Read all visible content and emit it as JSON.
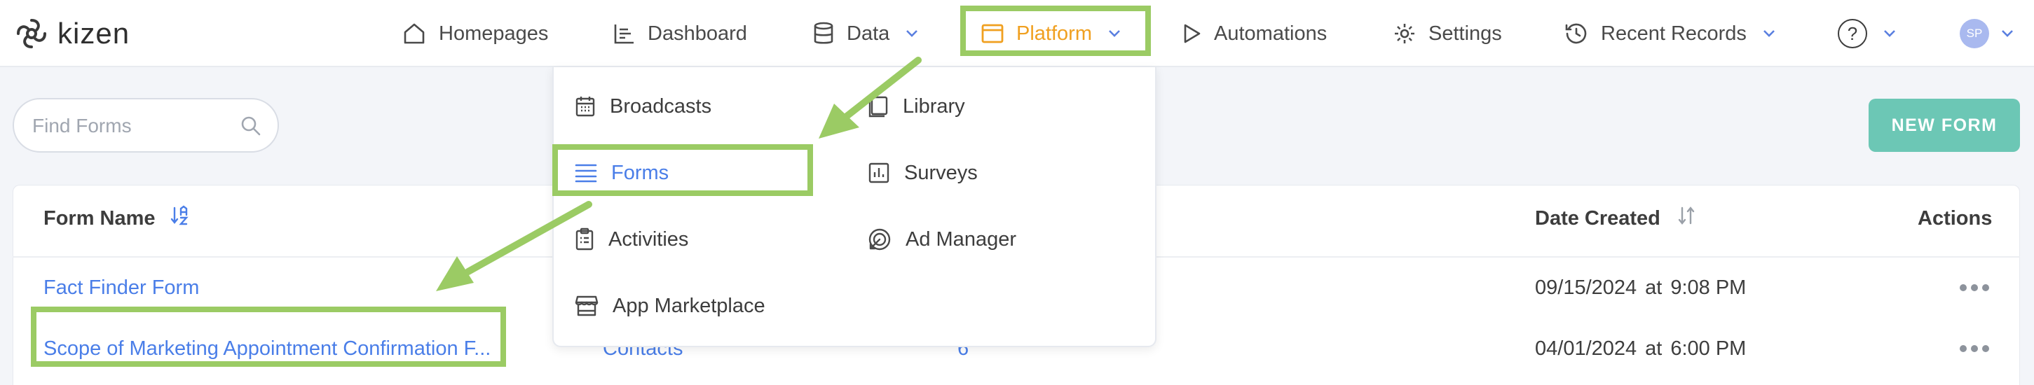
{
  "app": {
    "logo_text": "kizen"
  },
  "nav": {
    "homepages": "Homepages",
    "dashboard": "Dashboard",
    "data": "Data",
    "platform": "Platform",
    "automations": "Automations",
    "settings": "Settings",
    "recent_records": "Recent Records",
    "help": "?",
    "avatar_initials": "SP"
  },
  "platform_menu": {
    "broadcasts": "Broadcasts",
    "library": "Library",
    "forms": "Forms",
    "surveys": "Surveys",
    "activities": "Activities",
    "ad_manager": "Ad Manager",
    "app_marketplace": "App Marketplace"
  },
  "search": {
    "placeholder": "Find Forms",
    "value": ""
  },
  "toolbar": {
    "new_form_label": "NEW FORM"
  },
  "table": {
    "headers": {
      "form_name": "Form Name",
      "date_created": "Date Created",
      "actions": "Actions"
    },
    "rows": [
      {
        "name": "Fact Finder Form",
        "date": "09/15/2024",
        "at": "at",
        "time": "9:08 PM"
      },
      {
        "name": "Scope of Marketing Appointment Confirmation F...",
        "object": "Contacts",
        "count": "6",
        "date": "04/01/2024",
        "at": "at",
        "time": "6:00 PM"
      }
    ]
  },
  "colors": {
    "accent_active": "#f0a020",
    "link_blue": "#4a7ee8",
    "button_teal": "#6cc7b5",
    "highlight_green": "#9bcb64",
    "avatar_bg": "#a9b9ef"
  },
  "icons": {
    "logo": "kizen-swirl-icon",
    "homepages": "home-icon",
    "dashboard": "bar-chart-icon",
    "data": "database-icon",
    "platform": "window-icon",
    "automations": "play-icon",
    "settings": "gear-icon",
    "recent_records": "history-icon",
    "search": "search-icon",
    "broadcasts": "calendar-icon",
    "library": "book-icon",
    "forms": "list-lines-icon",
    "surveys": "chart-box-icon",
    "activities": "clipboard-icon",
    "ad_manager": "target-icon",
    "app_marketplace": "store-icon"
  }
}
